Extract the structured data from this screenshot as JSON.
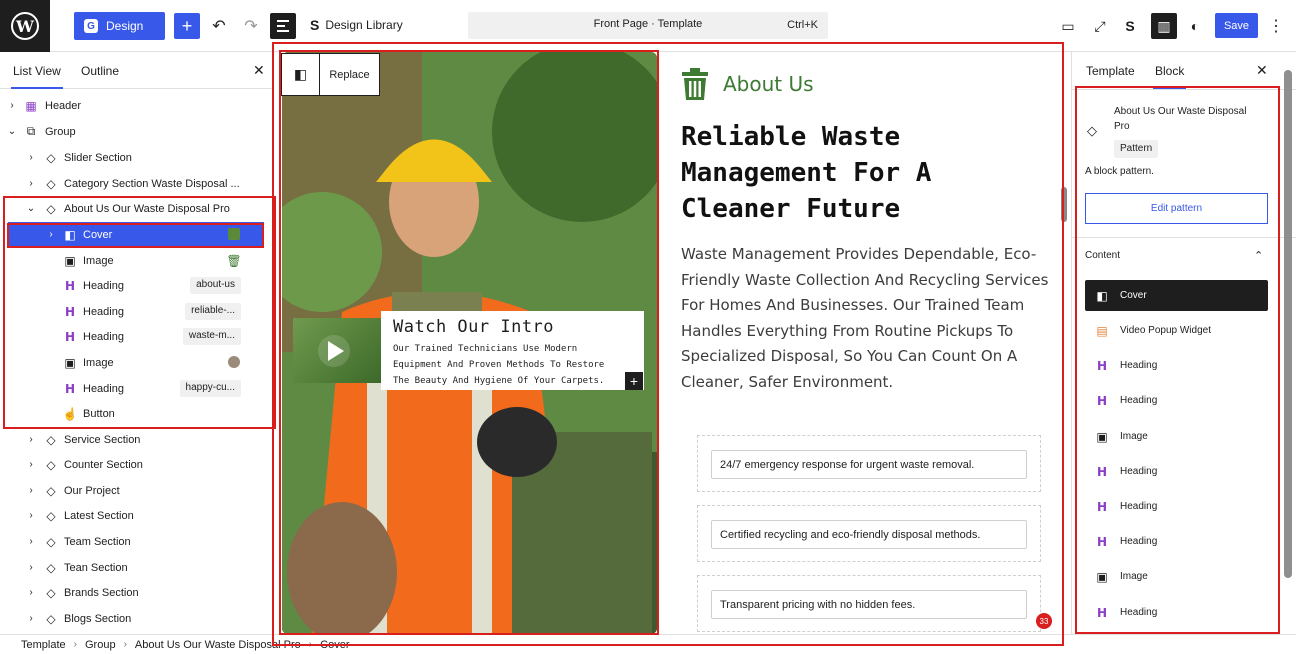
{
  "topbar": {
    "design_label": "Design",
    "design_library_label": "Design Library",
    "command_title": "Front Page · Template",
    "command_shortcut": "Ctrl+K",
    "save_label": "Save"
  },
  "left_panel": {
    "tabs": [
      "List View",
      "Outline"
    ],
    "items": [
      {
        "label": "Header"
      },
      {
        "label": "Group"
      },
      {
        "label": "Slider Section"
      },
      {
        "label": "Category Section Waste Disposal ..."
      },
      {
        "label": "About Us Our Waste Disposal Pro"
      },
      {
        "label": "Cover"
      },
      {
        "label": "Image"
      },
      {
        "label": "Heading",
        "tag": "about-us"
      },
      {
        "label": "Heading",
        "tag": "reliable-..."
      },
      {
        "label": "Heading",
        "tag": "waste-m..."
      },
      {
        "label": "Image"
      },
      {
        "label": "Heading",
        "tag": "happy-cu..."
      },
      {
        "label": "Button"
      },
      {
        "label": "Service Section"
      },
      {
        "label": "Counter Section"
      },
      {
        "label": "Our Project"
      },
      {
        "label": "Latest Section"
      },
      {
        "label": "Team Section"
      },
      {
        "label": "Tean Section"
      },
      {
        "label": "Brands Section"
      },
      {
        "label": "Blogs Section"
      }
    ]
  },
  "canvas": {
    "replace_label": "Replace",
    "intro_title": "Watch Our Intro",
    "intro_text_1": "Our Trained Technicians Use Modern",
    "intro_text_2": "Equipment And Proven Methods To Restore",
    "intro_text_3": "The Beauty And Hygiene Of Your Carpets.",
    "about_label": "About Us",
    "heading_1": "Reliable Waste",
    "heading_2": "Management For A",
    "heading_3": "Cleaner Future",
    "paragraph": "Waste Management Provides Dependable, Eco-Friendly Waste Collection And Recycling Services For Homes And Businesses. Our Trained Team Handles Everything From Routine Pickups To Specialized Disposal, So You Can Count On A Cleaner, Safer Environment.",
    "features": [
      "24/7 emergency response for urgent waste removal.",
      "Certified recycling and eco-friendly disposal methods.",
      "Transparent pricing with no hidden fees."
    ],
    "notification_count": "33"
  },
  "right_panel": {
    "tabs": [
      "Template",
      "Block"
    ],
    "block_title": "About Us Our Waste Disposal Pro",
    "pattern_tag": "Pattern",
    "block_description": "A block pattern.",
    "edit_pattern_label": "Edit pattern",
    "content_label": "Content",
    "content_items": [
      "Cover",
      "Video Popup Widget",
      "Heading",
      "Heading",
      "Image",
      "Heading",
      "Heading",
      "Heading",
      "Image",
      "Heading"
    ]
  },
  "breadcrumb": [
    "Template",
    "Group",
    "About Us Our Waste Disposal Pro",
    "Cover"
  ],
  "colors": {
    "accent": "#3858e9",
    "highlight": "#d91e1e",
    "brand_green": "#3d7a32",
    "heading_icon": "#8c3ec6"
  }
}
